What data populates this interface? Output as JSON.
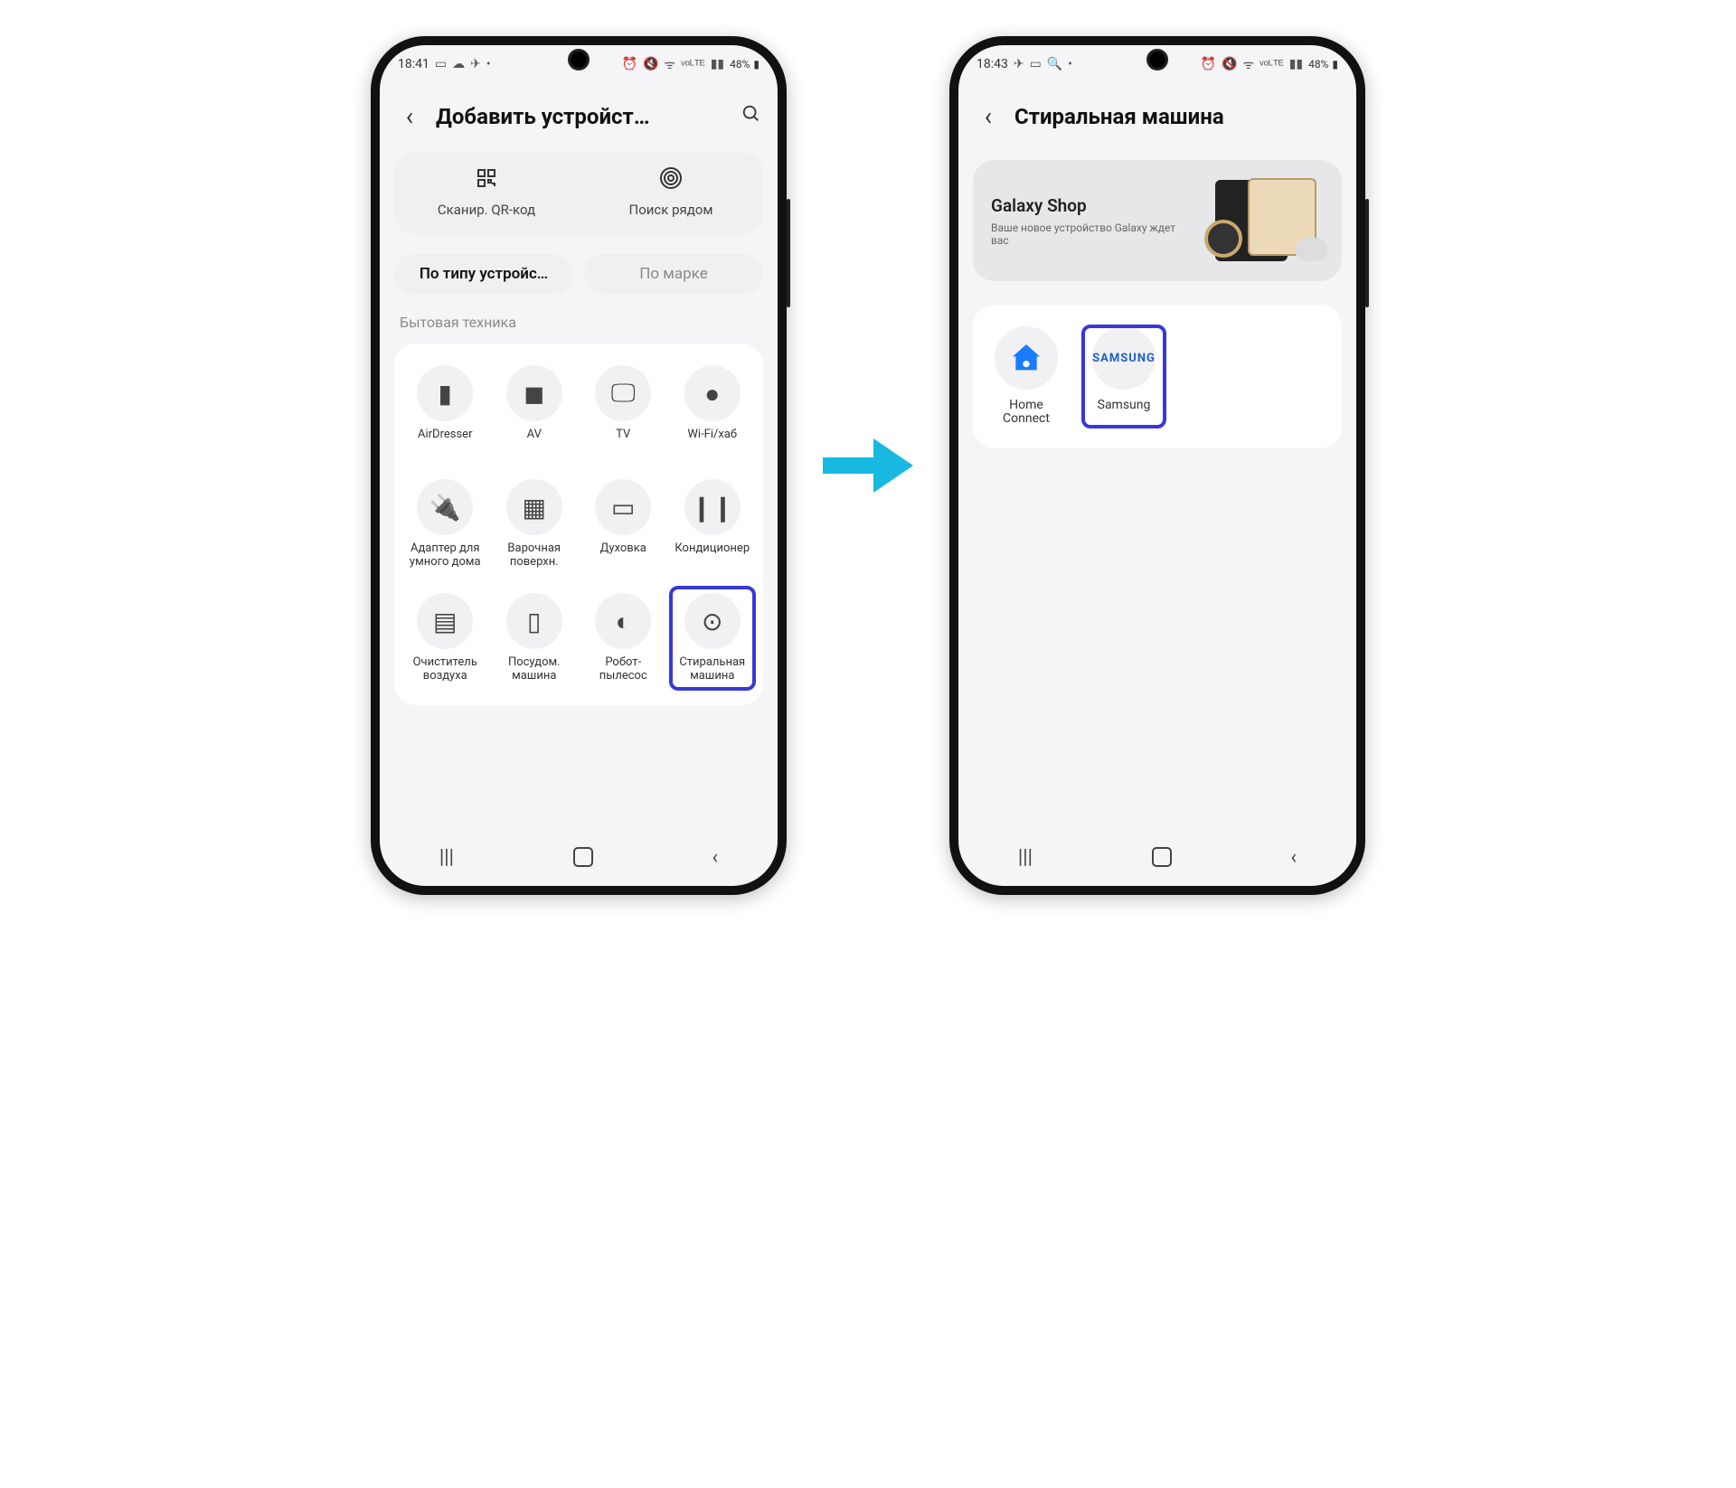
{
  "screen1": {
    "status": {
      "time": "18:41",
      "battery": "48%"
    },
    "title": "Добавить устройст…",
    "actions": {
      "qr": "Сканир. QR-код",
      "nearby": "Поиск рядом"
    },
    "tabs": {
      "by_type": "По типу устройс…",
      "by_brand": "По марке"
    },
    "section": "Бытовая техника",
    "items": [
      {
        "label": "AirDresser",
        "icon": "door"
      },
      {
        "label": "AV",
        "icon": "speaker"
      },
      {
        "label": "TV",
        "icon": "tv"
      },
      {
        "label": "Wi-Fi/хаб",
        "icon": "hub"
      },
      {
        "label": "Адаптер для умного дома",
        "icon": "usb"
      },
      {
        "label": "Варочная поверхн.",
        "icon": "cooktop"
      },
      {
        "label": "Духовка",
        "icon": "oven"
      },
      {
        "label": "Кондиционер",
        "icon": "ac"
      },
      {
        "label": "Очиститель воздуха",
        "icon": "purifier"
      },
      {
        "label": "Посудом. машина",
        "icon": "dish"
      },
      {
        "label": "Робот-пылесос",
        "icon": "robot"
      },
      {
        "label": "Стиральная машина",
        "icon": "washer",
        "highlight": true
      }
    ]
  },
  "screen2": {
    "status": {
      "time": "18:43",
      "battery": "48%"
    },
    "title": "Стиральная машина",
    "banner": {
      "title": "Galaxy Shop",
      "sub": "Ваше новое устройство Galaxy ждет вас"
    },
    "brands": [
      {
        "label": "Home Connect",
        "logo": "hc"
      },
      {
        "label": "Samsung",
        "logo": "samsung",
        "highlight": true
      }
    ]
  },
  "icons": {
    "door": "▮",
    "speaker": "◼",
    "tv": "🖵",
    "hub": "●",
    "usb": "🔌",
    "cooktop": "▦",
    "oven": "▭",
    "ac": "❙❙",
    "purifier": "▤",
    "dish": "▯",
    "robot": "◐",
    "washer": "⊙"
  }
}
